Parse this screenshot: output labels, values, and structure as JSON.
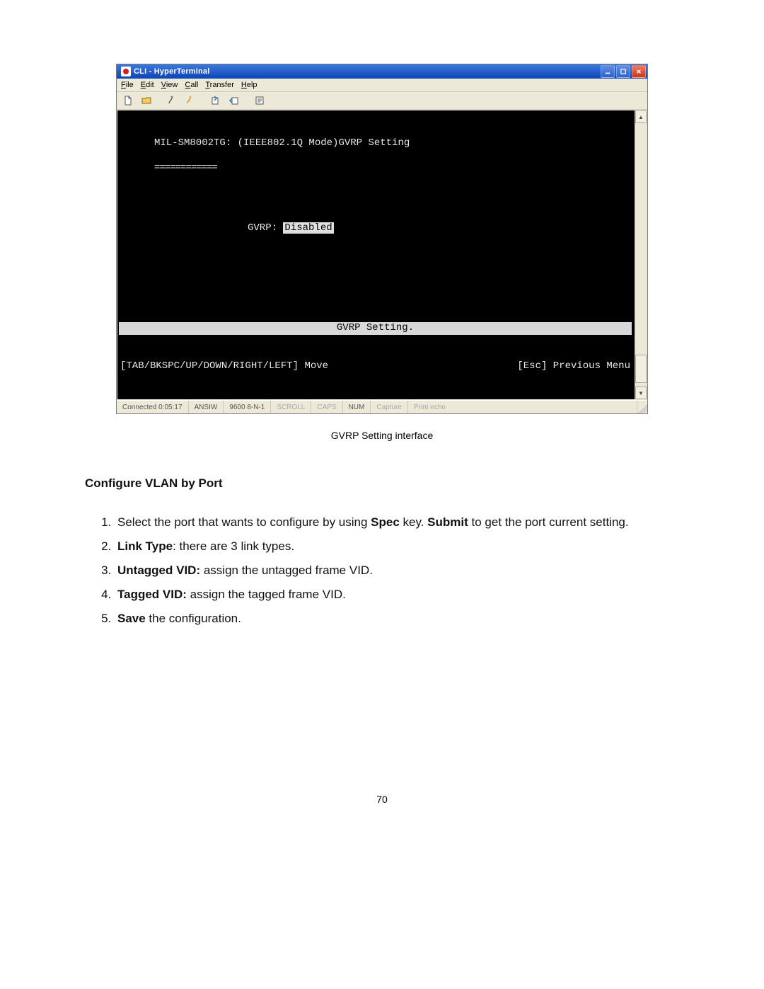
{
  "window": {
    "title": "CLI - HyperTerminal"
  },
  "menus": {
    "file": "File",
    "edit": "Edit",
    "view": "View",
    "call": "Call",
    "transfer": "Transfer",
    "help": "Help"
  },
  "terminal": {
    "header_line": "MIL-SM8002TG: (IEEE802.1Q Mode)GVRP Setting",
    "underline": "============",
    "gvrp_label": "GVRP: ",
    "gvrp_value": "Disabled",
    "setting_bar": "GVRP Setting.",
    "help_left": "[TAB/BKSPC/UP/DOWN/RIGHT/LEFT] Move",
    "help_right": "[Esc] Previous Menu"
  },
  "status": {
    "connected": "Connected 0:05:17",
    "emulation": "ANSIW",
    "port": "9600 8-N-1",
    "scroll": "SCROLL",
    "caps": "CAPS",
    "num": "NUM",
    "capture": "Capture",
    "printecho": "Print echo"
  },
  "doc": {
    "caption": "GVRP Setting interface",
    "section_heading": "Configure VLAN by Port",
    "steps": [
      {
        "pre": "Select the port that wants to configure by using ",
        "b1": "Spec",
        "mid": " key. ",
        "b2": "Submit",
        "post": " to get the port current setting."
      },
      {
        "b1": "Link Type",
        "post": ": there are 3 link types."
      },
      {
        "b1": "Untagged VID:",
        "post": " assign the untagged frame VID."
      },
      {
        "b1": "Tagged VID:",
        "post": " assign the tagged frame VID."
      },
      {
        "b1": "Save",
        "post": " the configuration."
      }
    ],
    "page_number": "70"
  }
}
